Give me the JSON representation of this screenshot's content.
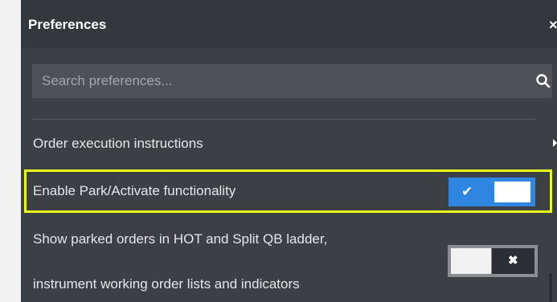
{
  "header": {
    "title": "Preferences"
  },
  "search": {
    "placeholder": "Search preferences..."
  },
  "items": [
    {
      "label": "Order execution instructions"
    },
    {
      "label": "Enable Park/Activate functionality",
      "toggle_on": true
    },
    {
      "label_line1": "Show parked orders in HOT and Split QB ladder,",
      "label_line2": "instrument working order lists and indicators",
      "toggle_on": false
    }
  ],
  "colors": {
    "accent": "#2e86e0",
    "highlight": "#e6ff1f",
    "panel_bg": "#3c4045"
  },
  "icons": {
    "close": "close-icon",
    "search": "search-icon",
    "submenu": "chevron-right-icon",
    "check": "check-icon",
    "x": "x-icon"
  }
}
